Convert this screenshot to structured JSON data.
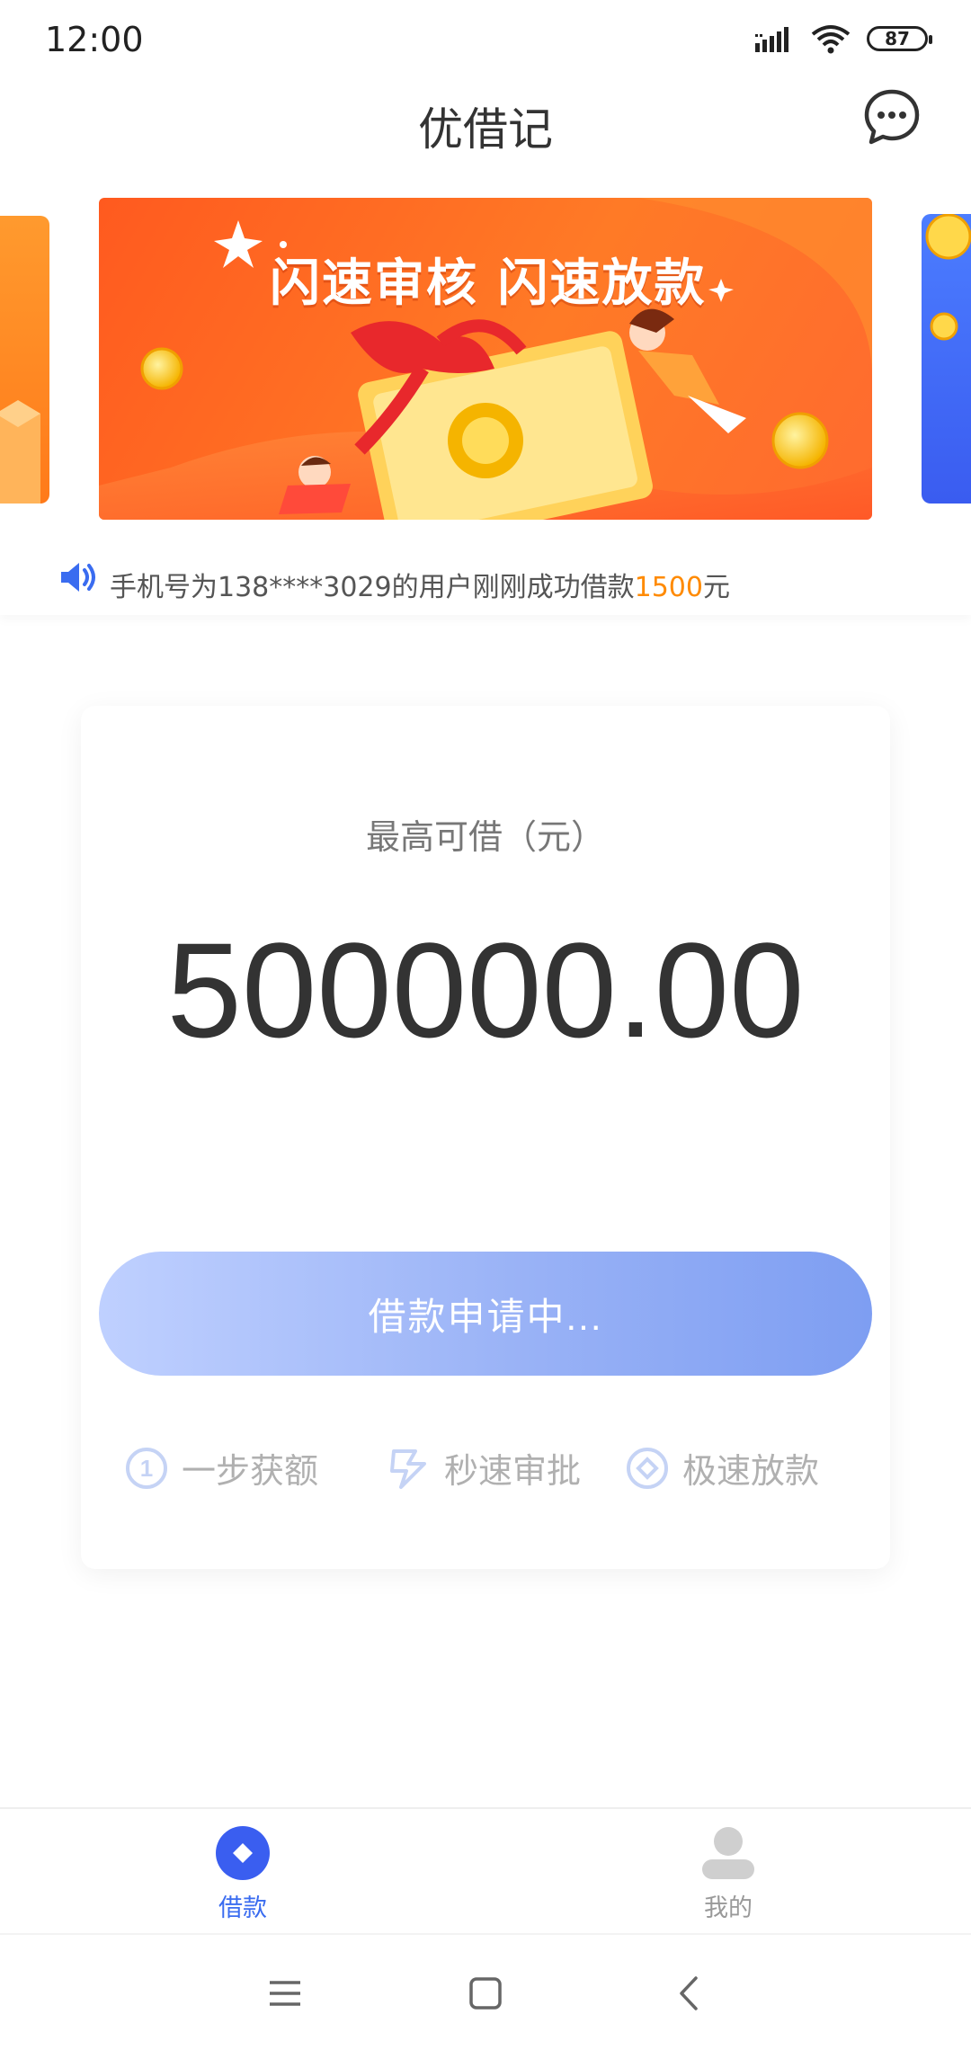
{
  "status_bar": {
    "time": "12:00",
    "battery": "87",
    "icons": [
      "signal-icon",
      "wifi-icon",
      "battery-icon"
    ]
  },
  "header": {
    "title": "优借记",
    "chat_icon": "chat-bubble-icon"
  },
  "banner": {
    "headline": "闪速审核 闪速放款"
  },
  "ticker": {
    "prefix": "手机号为138****3029的用户刚刚成功借款",
    "amount": "1500",
    "suffix": "元",
    "icon": "speaker-icon"
  },
  "loan_card": {
    "max_label": "最高可借（元）",
    "max_amount": "500000.00",
    "apply_button": "借款申请中...",
    "features": [
      {
        "label": "一步获额",
        "icon": "number-one-icon"
      },
      {
        "label": "秒速审批",
        "icon": "lightning-icon"
      },
      {
        "label": "极速放款",
        "icon": "diamond-icon"
      }
    ]
  },
  "tabbar": {
    "items": [
      {
        "label": "借款",
        "icon": "loan-tab-icon",
        "active": true
      },
      {
        "label": "我的",
        "icon": "profile-tab-icon",
        "active": false
      }
    ]
  },
  "colors": {
    "accent": "#3a6cf0",
    "highlight": "#ff8a00",
    "button_start": "#bfd0ff",
    "button_end": "#7e9ef2",
    "banner_orange": "#ff5a1f"
  }
}
